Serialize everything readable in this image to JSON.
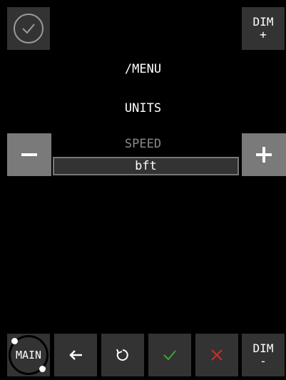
{
  "header": {
    "ok_icon": "check-circle-icon",
    "dim_up": {
      "line1": "DIM",
      "line2": "+"
    }
  },
  "menu": {
    "title": "/MENU",
    "section": "UNITS",
    "field_label": "SPEED",
    "field_value": "bft"
  },
  "controls": {
    "minus_icon": "minus-icon",
    "plus_icon": "plus-icon"
  },
  "footer": {
    "main_label": "MAIN",
    "back_icon": "arrow-left-icon",
    "reset_icon": "refresh-icon",
    "confirm_icon": "check-icon",
    "cancel_icon": "x-icon",
    "dim_down": {
      "line1": "DIM",
      "line2": "-"
    }
  },
  "colors": {
    "background": "#000000",
    "tile": "#333333",
    "pm_button": "#7a7a7a",
    "confirm_green": "#3fa535",
    "cancel_red": "#d12b2b"
  }
}
